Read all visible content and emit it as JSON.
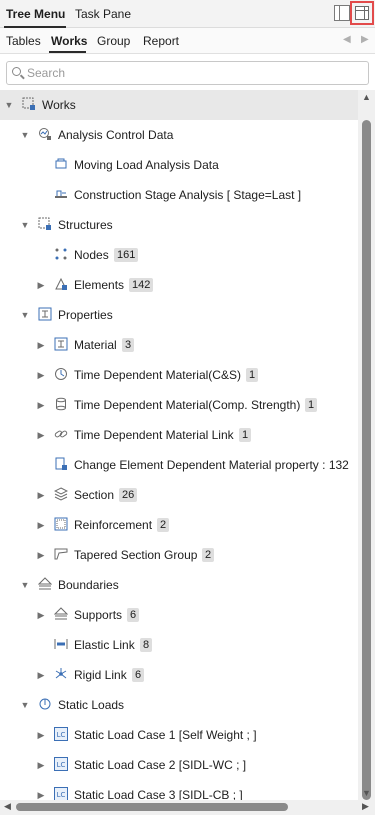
{
  "top_tabs": {
    "tree_menu": "Tree Menu",
    "task_pane": "Task Pane"
  },
  "sub_tabs": {
    "tables": "Tables",
    "works": "Works",
    "group": "Group",
    "report": "Report"
  },
  "search": {
    "placeholder": "Search"
  },
  "tree": [
    {
      "label": "Works",
      "badge": "",
      "level": 0,
      "expander": "expanded",
      "icon": "works-icon",
      "selected": true
    },
    {
      "label": "Analysis Control Data",
      "badge": "",
      "level": 1,
      "expander": "expanded",
      "icon": "analysis-control-icon"
    },
    {
      "label": "Moving Load Analysis Data",
      "badge": "",
      "level": 2,
      "expander": "none",
      "icon": "moving-load-icon"
    },
    {
      "label": "Construction Stage Analysis [ Stage=Last ]",
      "badge": "",
      "level": 2,
      "expander": "none",
      "icon": "construction-stage-icon"
    },
    {
      "label": "Structures",
      "badge": "",
      "level": 1,
      "expander": "expanded",
      "icon": "structures-icon"
    },
    {
      "label": "Nodes",
      "badge": "161",
      "level": 2,
      "expander": "none",
      "icon": "nodes-icon"
    },
    {
      "label": "Elements",
      "badge": "142",
      "level": 2,
      "expander": "collapsed",
      "icon": "elements-icon"
    },
    {
      "label": "Properties",
      "badge": "",
      "level": 1,
      "expander": "expanded",
      "icon": "properties-icon"
    },
    {
      "label": "Material",
      "badge": "3",
      "level": 2,
      "expander": "collapsed",
      "icon": "material-icon"
    },
    {
      "label": "Time Dependent Material(C&S)",
      "badge": "1",
      "level": 2,
      "expander": "collapsed",
      "icon": "time-material-icon"
    },
    {
      "label": "Time Dependent Material(Comp. Strength)",
      "badge": "1",
      "level": 2,
      "expander": "collapsed",
      "icon": "cylinder-icon"
    },
    {
      "label": "Time Dependent Material Link",
      "badge": "1",
      "level": 2,
      "expander": "collapsed",
      "icon": "link-icon"
    },
    {
      "label": "Change Element Dependent Material property : 132",
      "badge": "",
      "level": 2,
      "expander": "none",
      "icon": "change-material-icon"
    },
    {
      "label": "Section",
      "badge": "26",
      "level": 2,
      "expander": "collapsed",
      "icon": "section-icon"
    },
    {
      "label": "Reinforcement",
      "badge": "2",
      "level": 2,
      "expander": "collapsed",
      "icon": "reinforcement-icon"
    },
    {
      "label": "Tapered Section Group",
      "badge": "2",
      "level": 2,
      "expander": "collapsed",
      "icon": "tapered-section-icon"
    },
    {
      "label": "Boundaries",
      "badge": "",
      "level": 1,
      "expander": "expanded",
      "icon": "boundaries-icon"
    },
    {
      "label": "Supports",
      "badge": "6",
      "level": 2,
      "expander": "collapsed",
      "icon": "supports-icon"
    },
    {
      "label": "Elastic Link",
      "badge": "8",
      "level": 2,
      "expander": "none",
      "icon": "elastic-link-icon"
    },
    {
      "label": "Rigid Link",
      "badge": "6",
      "level": 2,
      "expander": "collapsed",
      "icon": "rigid-link-icon"
    },
    {
      "label": "Static Loads",
      "badge": "",
      "level": 1,
      "expander": "expanded",
      "icon": "static-loads-icon"
    },
    {
      "label": "Static Load Case 1 [Self Weight ; ]",
      "badge": "",
      "level": 2,
      "expander": "collapsed",
      "icon": "load-case-icon"
    },
    {
      "label": "Static Load Case 2 [SIDL-WC ; ]",
      "badge": "",
      "level": 2,
      "expander": "collapsed",
      "icon": "load-case-icon"
    },
    {
      "label": "Static Load Case 3 [SIDL-CB ; ]",
      "badge": "",
      "level": 2,
      "expander": "collapsed",
      "icon": "load-case-icon"
    }
  ],
  "load_case_icon_text": "LC",
  "colors": {
    "accent_blue": "#3b6fb5",
    "selected_row": "#e8e8e8",
    "highlight_border": "#e24a4a"
  }
}
